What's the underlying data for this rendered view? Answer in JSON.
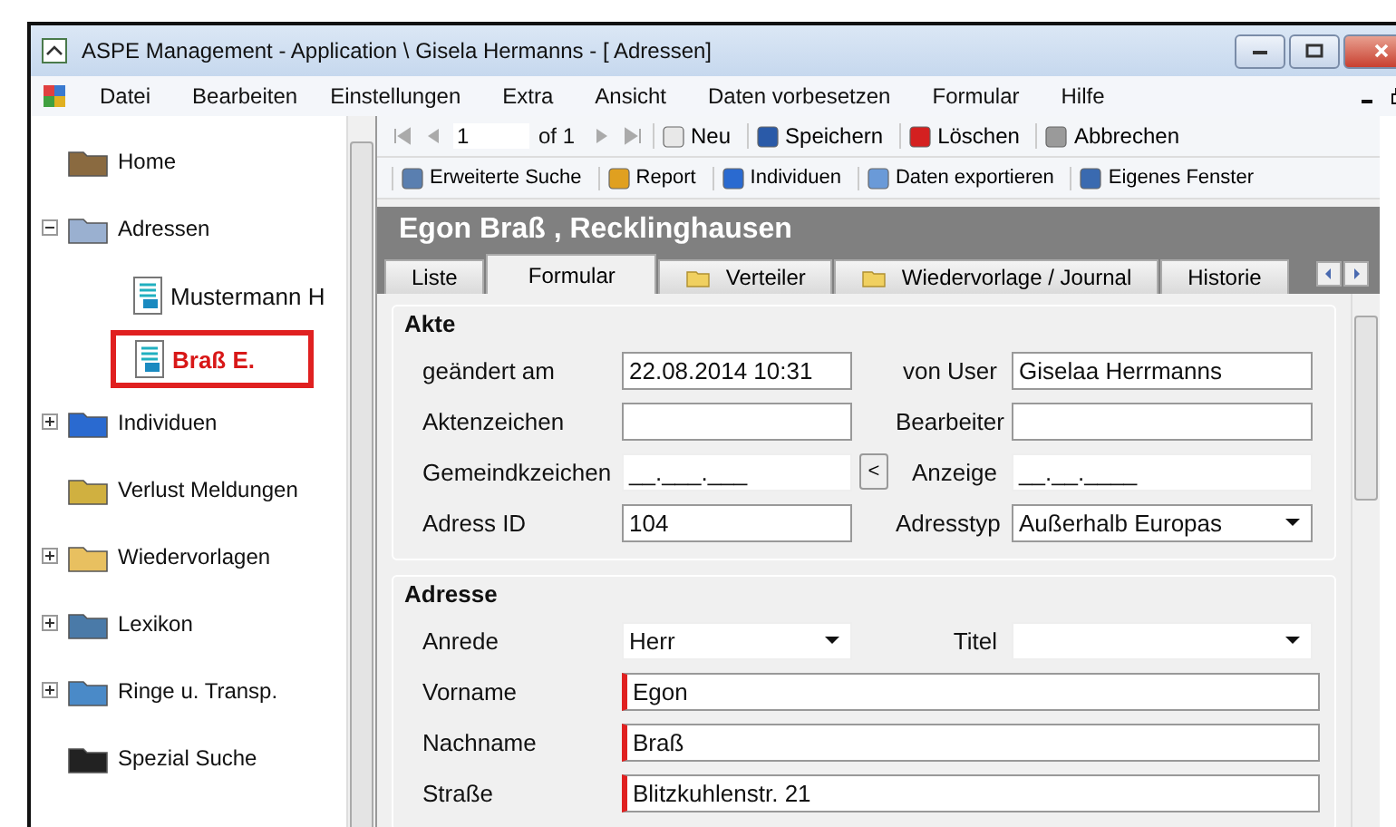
{
  "window": {
    "title": "ASPE Management - Application \\ Gisela Hermanns - [ Adressen]"
  },
  "menu": [
    "Datei",
    "Bearbeiten",
    "Einstellungen",
    "Extra",
    "Ansicht",
    "Daten vorbesetzen",
    "Formular",
    "Hilfe"
  ],
  "tree": [
    {
      "label": "Home",
      "selected": false
    },
    {
      "label": "Adressen",
      "selected": false,
      "expanded": true,
      "children": [
        {
          "label": "Mustermann H",
          "selected": false
        },
        {
          "label": "Braß E.",
          "selected": true
        }
      ]
    },
    {
      "label": "Individuen",
      "selected": false,
      "expanded": false
    },
    {
      "label": "Verlust Meldungen",
      "selected": false
    },
    {
      "label": "Wiedervorlagen",
      "selected": false,
      "expanded": false
    },
    {
      "label": "Lexikon",
      "selected": false,
      "expanded": false
    },
    {
      "label": "Ringe u. Transp.",
      "selected": false,
      "expanded": false
    },
    {
      "label": "Spezial Suche",
      "selected": false
    }
  ],
  "navigator": {
    "page": "1",
    "of": "of 1"
  },
  "toolbar": [
    {
      "label": "Neu",
      "kind": "new"
    },
    {
      "label": "Speichern",
      "kind": "save"
    },
    {
      "label": "Löschen",
      "kind": "delete"
    },
    {
      "label": "Abbrechen",
      "kind": "cancel"
    }
  ],
  "toolbar2": [
    {
      "label": "Erweiterte Suche",
      "kind": "search"
    },
    {
      "label": "Report",
      "kind": "report"
    },
    {
      "label": "Individuen",
      "kind": "bird"
    },
    {
      "label": "Daten exportieren",
      "kind": "export"
    },
    {
      "label": "Eigenes Fenster",
      "kind": "window"
    }
  ],
  "header": "Egon Braß , Recklinghausen",
  "tabs": [
    {
      "label": "Liste",
      "selected": false,
      "folder": false
    },
    {
      "label": "Formular",
      "selected": true,
      "folder": false
    },
    {
      "label": "Verteiler",
      "selected": false,
      "folder": true
    },
    {
      "label": "Wiedervorlage / Journal",
      "selected": false,
      "folder": true
    },
    {
      "label": "Historie",
      "selected": false,
      "folder": false
    }
  ],
  "akte": {
    "title": "Akte",
    "rows": [
      [
        {
          "label": "geändert am",
          "value": "22.08.2014 10:31",
          "kind": "text"
        },
        {
          "label": "von User",
          "value": "Giselaa Herrmanns",
          "kind": "text"
        }
      ],
      [
        {
          "label": "Aktenzeichen",
          "kind": "text"
        },
        {
          "label": "Bearbeiter",
          "kind": "text"
        }
      ],
      [
        {
          "label": "Gemeindkzeichen",
          "value": "__.___.___",
          "kind": "masked",
          "button": "<"
        },
        {
          "label": "Anzeige",
          "value": "__.__.____",
          "kind": "masked"
        }
      ],
      [
        {
          "label": "Adress ID",
          "value": "104",
          "kind": "text"
        },
        {
          "label": "Adresstyp",
          "value": "Außerhalb Europas",
          "kind": "dropdown"
        }
      ]
    ]
  },
  "adresse": {
    "title": "Adresse",
    "pair": [
      {
        "label": "Anrede",
        "value": "Herr",
        "kind": "dropdown"
      },
      {
        "label": "Titel",
        "kind": "dropdown"
      }
    ],
    "fields": [
      {
        "label": "Vorname",
        "value": "Egon",
        "required": true
      },
      {
        "label": "Nachname",
        "value": "Braß",
        "required": true
      },
      {
        "label": "Straße",
        "value": "Blitzkuhlenstr. 21",
        "required": true
      }
    ]
  }
}
